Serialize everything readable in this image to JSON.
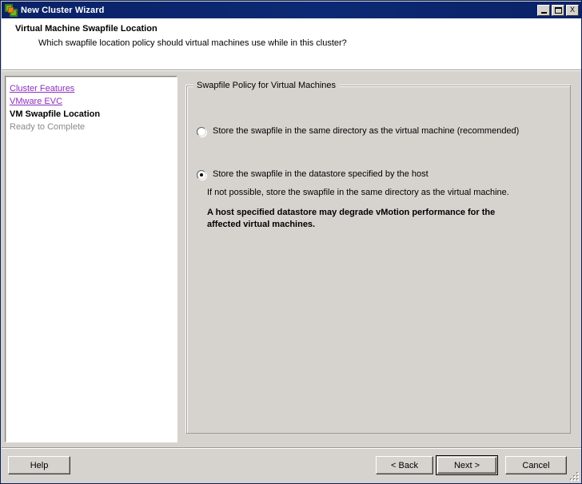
{
  "window": {
    "title": "New Cluster Wizard",
    "icon": "vmware-cluster-icon",
    "controls": {
      "minimize": "minimize-button",
      "maximize": "maximize-button",
      "close_label": "X"
    }
  },
  "header": {
    "title": "Virtual Machine Swapfile Location",
    "subtitle": "Which swapfile location policy should virtual machines use while in this cluster?"
  },
  "sidebar": {
    "items": [
      {
        "label": "Cluster Features",
        "state": "link"
      },
      {
        "label": "VMware EVC",
        "state": "link"
      },
      {
        "label": "VM Swapfile Location",
        "state": "current"
      },
      {
        "label": "Ready to Complete",
        "state": "pending"
      }
    ]
  },
  "main": {
    "group_title": "Swapfile Policy for Virtual Machines",
    "options": [
      {
        "label": "Store the swapfile in the same directory as the virtual machine (recommended)",
        "selected": false
      },
      {
        "label": "Store the swapfile in the datastore specified by the host",
        "selected": true,
        "description": "If not possible, store the swapfile in the same directory as the virtual machine.",
        "warning_line1": "A host specified datastore may degrade vMotion performance for the",
        "warning_line2": "affected virtual machines."
      }
    ]
  },
  "footer": {
    "help_label": "Help",
    "back_label": "< Back",
    "next_label": "Next >",
    "cancel_label": "Cancel"
  },
  "colors": {
    "titlebar": "#0a2166",
    "face": "#d6d3ce",
    "link": "#8c2fbd",
    "pending_text": "#8a8a8a",
    "panel": "#ffffff"
  }
}
